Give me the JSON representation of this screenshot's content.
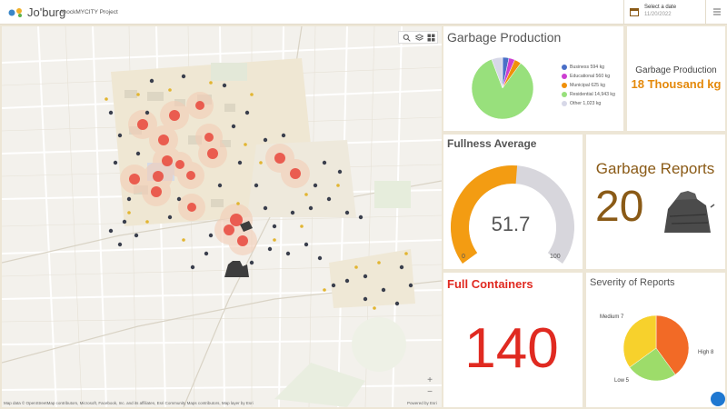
{
  "header": {
    "app_name": "Jo'burg",
    "app_subtitle": "#hockMYCITY Project",
    "date_label": "Select a date",
    "date_value": "11/20/2022",
    "icons": [
      "logo-icon",
      "calendar-icon",
      "menu-icon"
    ]
  },
  "map": {
    "attribution": "Map data © OpenStreetMap contributors, Microsoft, Facebook, Inc. and its affiliates, Esri Community Maps contributors, Map layer by Esri",
    "powered": "Powered by Esri",
    "zoom_in": "+",
    "zoom_out": "−",
    "tools": [
      "search-icon",
      "layers-icon",
      "basemap-icon"
    ]
  },
  "garbage_production": {
    "title": "Garbage Production",
    "legend": [
      {
        "label": "Business 594 kg",
        "color": "#4a6fc7"
      },
      {
        "label": "Educational 560 kg",
        "color": "#cc3fd1"
      },
      {
        "label": "Municipal 625 kg",
        "color": "#f0900a"
      },
      {
        "label": "Residential 14,943 kg",
        "color": "#98e07c"
      },
      {
        "label": "Other 1,023 kg",
        "color": "#d7d8e8"
      }
    ]
  },
  "chart_data": {
    "type": "pie",
    "categories": [
      "Business",
      "Educational",
      "Municipal",
      "Residential",
      "Other"
    ],
    "values": [
      594,
      560,
      625,
      14943,
      1023
    ],
    "colors": [
      "#4a6fc7",
      "#cc3fd1",
      "#f0900a",
      "#98e07c",
      "#d7d8e8"
    ]
  },
  "garbage_total": {
    "label": "Garbage Production",
    "value": "18 Thousand kg"
  },
  "fullness": {
    "title": "Fullness Average",
    "value": "51.7",
    "min": "0",
    "max": "100",
    "fraction": 0.517,
    "fill_color": "#f39c12",
    "track_color": "#d7d6dc"
  },
  "reports": {
    "title": "Garbage Reports",
    "value": "20"
  },
  "full_containers": {
    "title": "Full Containers",
    "value": "140"
  },
  "severity": {
    "title": "Severity of Reports",
    "slices": [
      {
        "label": "High 8",
        "value": 8,
        "color": "#f26a26"
      },
      {
        "label": "Low 5",
        "value": 5,
        "color": "#9ddc6a"
      },
      {
        "label": "Medium 7",
        "value": 7,
        "color": "#f7d12c"
      }
    ]
  }
}
